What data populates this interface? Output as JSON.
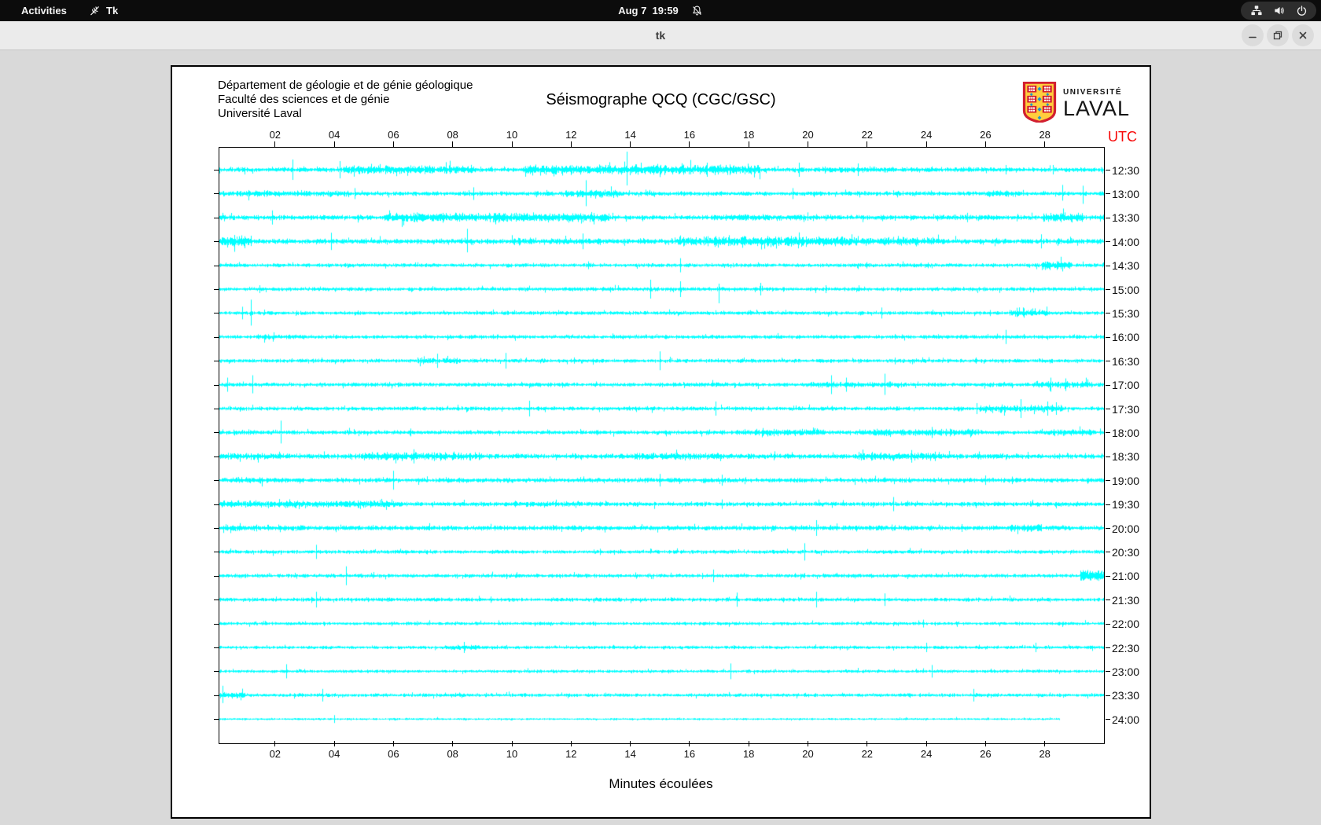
{
  "top_bar": {
    "activities_label": "Activities",
    "app_label": "Tk",
    "clock": "Aug 7  19:59",
    "icons": [
      "tk-feather",
      "bell-slash",
      "network-wired",
      "volume",
      "power"
    ]
  },
  "title_bar": {
    "title": "tk",
    "buttons": [
      "minimize",
      "maximize",
      "close"
    ]
  },
  "window": {
    "header": {
      "dept_lines": [
        "Département de géologie et de génie géologique",
        "Faculté des sciences et de génie",
        "Université Laval"
      ],
      "title": "Séismographe QCQ (CGC/GSC)",
      "logo": {
        "line1": "UNIVERSITÉ",
        "line2": "LAVAL"
      }
    }
  },
  "chart_data": {
    "type": "seismograph-helicorder",
    "title": "Séismographe QCQ (CGC/GSC)",
    "xlabel": "Minutes écoulées",
    "right_axis_label": "UTC",
    "xlim": [
      0,
      30.1
    ],
    "x_tick_labels": [
      "02",
      "04",
      "06",
      "08",
      "10",
      "12",
      "14",
      "16",
      "18",
      "20",
      "22",
      "24",
      "26",
      "28"
    ],
    "x_tick_minutes": [
      2,
      4,
      6,
      8,
      10,
      12,
      14,
      16,
      18,
      20,
      22,
      24,
      26,
      28
    ],
    "trace_color": "#00ffff",
    "border_color": "#000000",
    "utc_color": "#f70808",
    "rows": [
      {
        "t": "12:30",
        "a": 2.6,
        "end": 30.1,
        "b": [
          [
            4.3,
            8.8,
            4.6
          ],
          [
            10.4,
            18.4,
            5.2
          ],
          [
            20.5,
            23,
            3.6
          ]
        ],
        "s": [
          [
            2.6,
            13,
            13
          ],
          [
            4.2,
            11,
            11
          ],
          [
            13.9,
            23,
            20
          ],
          [
            16.6,
            9,
            9
          ],
          [
            19.7,
            9,
            9
          ],
          [
            21.7,
            8,
            8
          ],
          [
            26.7,
            6,
            6
          ],
          [
            28.3,
            6,
            6
          ]
        ]
      },
      {
        "t": "13:00",
        "a": 2.4,
        "end": 30.1,
        "b": [
          [
            0.2,
            4.5,
            3.4
          ],
          [
            11.8,
            13.6,
            4.2
          ],
          [
            26,
            27.2,
            3.2
          ]
        ],
        "s": [
          [
            4.7,
            7,
            7
          ],
          [
            8.7,
            8,
            8
          ],
          [
            12.5,
            17,
            16
          ],
          [
            19.5,
            7,
            7
          ],
          [
            28.6,
            11,
            9
          ],
          [
            29.3,
            10,
            13
          ]
        ]
      },
      {
        "t": "13:30",
        "a": 2.7,
        "end": 30.1,
        "b": [
          [
            5.7,
            13.3,
            5.0
          ],
          [
            17,
            20,
            3.4
          ],
          [
            27.9,
            29.3,
            5.5
          ]
        ],
        "s": [
          [
            1.9,
            9,
            9
          ],
          [
            6.3,
            4,
            12
          ],
          [
            25.4,
            6,
            6
          ]
        ]
      },
      {
        "t": "14:00",
        "a": 2.8,
        "end": 30.1,
        "b": [
          [
            0.2,
            1.2,
            6.5
          ],
          [
            10,
            13,
            3.6
          ],
          [
            15.5,
            21.5,
            5.4
          ],
          [
            21.5,
            24.5,
            4.4
          ]
        ],
        "s": [
          [
            3.9,
            11,
            11
          ],
          [
            8.5,
            16,
            14
          ],
          [
            12.4,
            10,
            10
          ],
          [
            27.9,
            9,
            9
          ]
        ]
      },
      {
        "t": "14:30",
        "a": 2.1,
        "end": 30.1,
        "b": [
          [
            27.9,
            28.9,
            4.8
          ]
        ],
        "s": [
          [
            12.6,
            5,
            5
          ],
          [
            15.7,
            9,
            9
          ],
          [
            22,
            4,
            4
          ]
        ]
      },
      {
        "t": "15:00",
        "a": 2.1,
        "end": 30.1,
        "b": [],
        "s": [
          [
            1.5,
            5,
            5
          ],
          [
            14.7,
            12,
            12
          ],
          [
            15.7,
            10,
            10
          ],
          [
            17,
            7,
            18
          ],
          [
            18.4,
            8,
            8
          ],
          [
            20.6,
            5,
            5
          ]
        ]
      },
      {
        "t": "15:30",
        "a": 2.1,
        "end": 30.1,
        "b": [
          [
            26.8,
            28.1,
            3.8
          ]
        ],
        "s": [
          [
            0.9,
            8,
            8
          ],
          [
            1.2,
            17,
            16
          ],
          [
            22.5,
            7,
            7
          ],
          [
            27.3,
            6,
            6
          ]
        ]
      },
      {
        "t": "16:00",
        "a": 2.1,
        "end": 30.1,
        "b": [
          [
            1.4,
            2.8,
            3.0
          ]
        ],
        "s": [
          [
            26.7,
            9,
            9
          ],
          [
            9.5,
            3,
            3
          ]
        ]
      },
      {
        "t": "16:30",
        "a": 2.1,
        "end": 30.1,
        "b": [
          [
            6.8,
            8.2,
            3.4
          ]
        ],
        "s": [
          [
            7.5,
            9,
            9
          ],
          [
            9.8,
            10,
            10
          ],
          [
            15,
            12,
            12
          ]
        ]
      },
      {
        "t": "17:00",
        "a": 2.3,
        "end": 30.1,
        "b": [
          [
            20,
            23,
            3.4
          ],
          [
            27.8,
            29.6,
            3.8
          ]
        ],
        "s": [
          [
            0.4,
            9,
            9
          ],
          [
            1.25,
            12,
            11
          ],
          [
            20.8,
            12,
            12
          ],
          [
            21.3,
            9,
            9
          ],
          [
            22.6,
            14,
            13
          ],
          [
            28.2,
            9,
            9
          ],
          [
            28.7,
            8,
            8
          ]
        ]
      },
      {
        "t": "17:30",
        "a": 2.2,
        "end": 30.1,
        "b": [
          [
            25.8,
            28.6,
            3.8
          ]
        ],
        "s": [
          [
            10.6,
            10,
            10
          ],
          [
            16.9,
            9,
            9
          ],
          [
            25.7,
            7,
            7
          ],
          [
            27.2,
            12,
            12
          ],
          [
            28.1,
            9,
            9
          ],
          [
            28.4,
            8,
            8
          ]
        ]
      },
      {
        "t": "18:00",
        "a": 2.3,
        "end": 30.1,
        "b": [
          [
            17.6,
            20.6,
            3.6
          ],
          [
            21.8,
            25.8,
            3.8
          ],
          [
            28,
            29.6,
            3.4
          ]
        ],
        "s": [
          [
            2.2,
            15,
            14
          ],
          [
            6.6,
            5,
            5
          ],
          [
            24.2,
            7,
            7
          ]
        ]
      },
      {
        "t": "18:30",
        "a": 2.9,
        "end": 30.1,
        "b": [
          [
            0.2,
            2.2,
            3.8
          ],
          [
            5,
            9,
            4.4
          ],
          [
            14,
            17,
            3.8
          ],
          [
            21.7,
            24.5,
            4.4
          ]
        ],
        "s": [
          [
            6.7,
            9,
            9
          ],
          [
            23.5,
            8,
            8
          ],
          [
            24.3,
            6,
            6
          ]
        ]
      },
      {
        "t": "19:00",
        "a": 2.5,
        "end": 30.1,
        "b": [
          [
            0.2,
            3,
            3.3
          ]
        ],
        "s": [
          [
            6,
            12,
            12
          ],
          [
            15,
            8,
            8
          ],
          [
            17.1,
            7,
            7
          ],
          [
            26,
            6,
            6
          ]
        ]
      },
      {
        "t": "19:30",
        "a": 2.5,
        "end": 30.1,
        "b": [
          [
            0.2,
            6.2,
            4.0
          ],
          [
            10,
            13,
            3.1
          ]
        ],
        "s": [
          [
            17.1,
            6,
            6
          ],
          [
            22.9,
            9,
            9
          ]
        ]
      },
      {
        "t": "20:00",
        "a": 2.7,
        "end": 30.1,
        "b": [
          [
            0.2,
            3,
            3.3
          ],
          [
            26.8,
            27.9,
            4.4
          ]
        ],
        "s": [
          [
            20.3,
            10,
            10
          ],
          [
            25.2,
            5,
            5
          ]
        ]
      },
      {
        "t": "20:30",
        "a": 2.1,
        "end": 30.1,
        "b": [],
        "s": [
          [
            3.4,
            9,
            9
          ],
          [
            13,
            4,
            4
          ],
          [
            19.9,
            11,
            11
          ]
        ]
      },
      {
        "t": "21:00",
        "a": 2.1,
        "end": 30.1,
        "b": [
          [
            29.2,
            30.1,
            7.0
          ]
        ],
        "s": [
          [
            4.4,
            12,
            12
          ],
          [
            16.8,
            8,
            8
          ]
        ]
      },
      {
        "t": "21:30",
        "a": 2.1,
        "end": 30.1,
        "b": [],
        "s": [
          [
            3.4,
            10,
            10
          ],
          [
            9.3,
            4,
            4
          ],
          [
            17.6,
            9,
            9
          ],
          [
            20.3,
            10,
            10
          ],
          [
            22.6,
            8,
            8
          ]
        ]
      },
      {
        "t": "22:00",
        "a": 1.8,
        "end": 30.1,
        "b": [],
        "s": [
          [
            6.8,
            3,
            3
          ],
          [
            23.9,
            5,
            5
          ]
        ]
      },
      {
        "t": "22:30",
        "a": 1.8,
        "end": 30.1,
        "b": [
          [
            7.9,
            8.9,
            3.0
          ]
        ],
        "s": [
          [
            8.4,
            7,
            7
          ],
          [
            24,
            6,
            6
          ],
          [
            27.7,
            6,
            6
          ]
        ]
      },
      {
        "t": "23:00",
        "a": 1.8,
        "end": 30.1,
        "b": [],
        "s": [
          [
            2.4,
            9,
            9
          ],
          [
            17.4,
            10,
            10
          ],
          [
            24.2,
            8,
            8
          ]
        ]
      },
      {
        "t": "23:30",
        "a": 2.0,
        "end": 30.1,
        "b": [
          [
            0.15,
            1,
            3.5
          ]
        ],
        "s": [
          [
            0.25,
            12,
            10
          ],
          [
            3.6,
            8,
            8
          ],
          [
            25.6,
            8,
            8
          ]
        ]
      },
      {
        "t": "24:00",
        "a": 1.1,
        "end": 28.5,
        "b": [],
        "s": [
          [
            4,
            5,
            5
          ]
        ]
      }
    ]
  }
}
